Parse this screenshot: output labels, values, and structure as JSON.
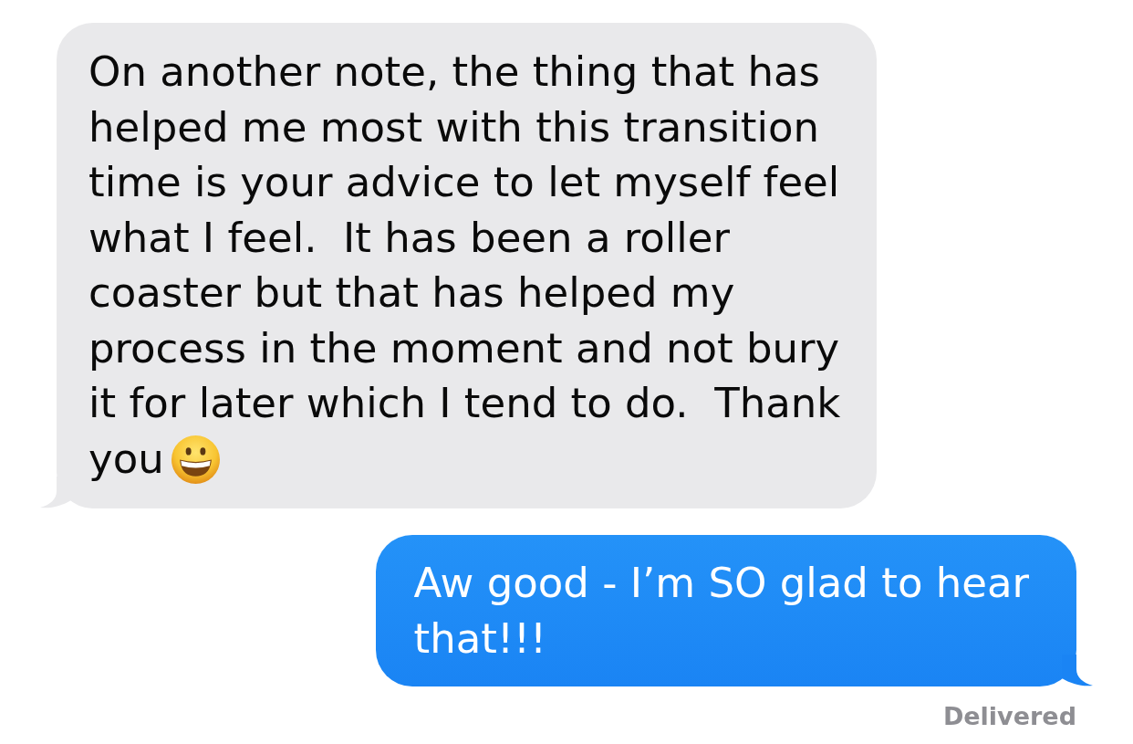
{
  "messages": [
    {
      "kind": "received",
      "text": "On another note, the thing that has\nhelped me most with this transition\ntime is your advice to let myself feel\nwhat I feel.  It has been a roller\ncoaster but that has helped my\nprocess in the moment and not bury\nit for later which I tend to do.  Thank\nyou",
      "emoji": true
    },
    {
      "kind": "sent",
      "text": "Aw good - I’m SO glad to hear\nthat!!!",
      "status": "Delivered"
    }
  ]
}
